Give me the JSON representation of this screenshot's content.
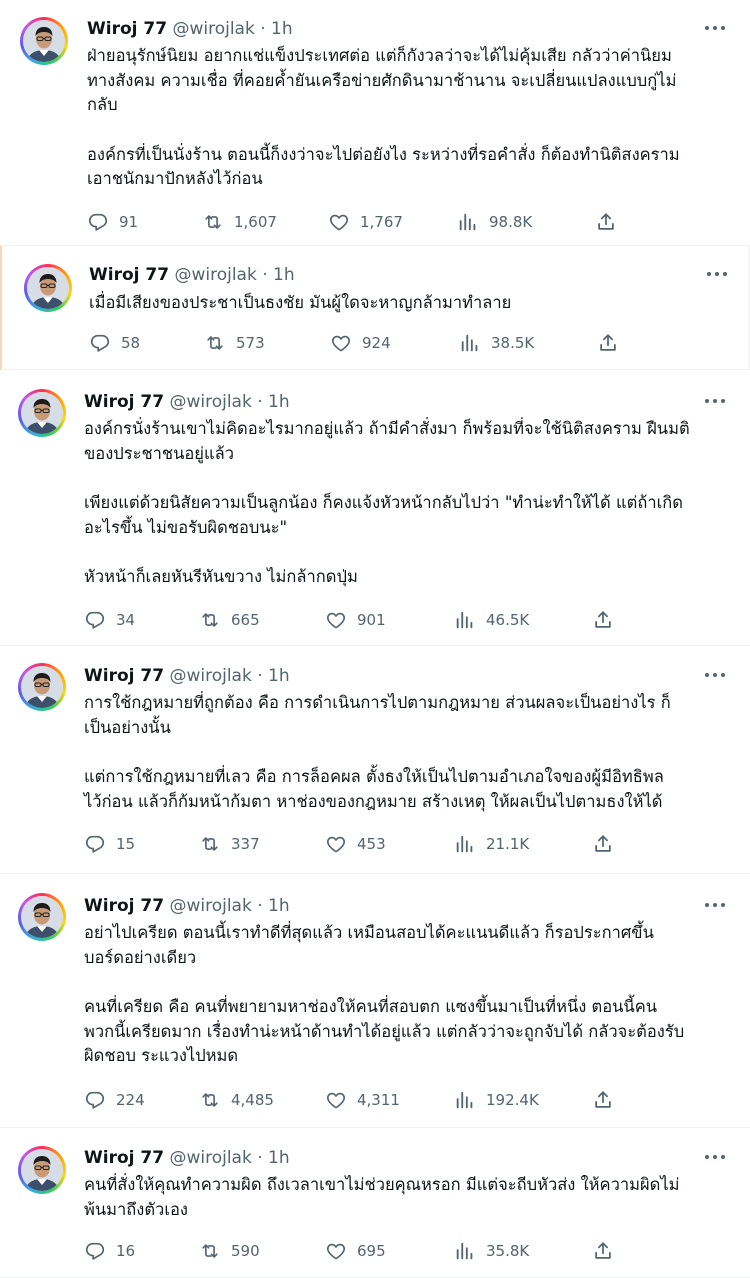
{
  "tweets": [
    {
      "name": "Wiroj 77",
      "handle": "@wirojlak",
      "time": "1h",
      "paragraphs": [
        "ฝ่ายอนุรักษ์นิยม อยากแช่แข็งประเทศต่อ แต่ก็กังวลว่าจะได้ไม่คุ้มเสีย กลัวว่าค่านิยม\nทางสังคม ความเชื่อ ที่คอยค้ำยันเครือข่ายศักดินามาช้านาน จะเปลี่ยนแปลงแบบกู่ไม่\nกลับ",
        "องค์กรที่เป็นนั่งร้าน ตอนนี้ก็งงว่าจะไปต่อยังไง ระหว่างที่รอคำสั่ง ก็ต้องทำนิติสงคราม\nเอาชนักมาปักหลังไว้ก่อน"
      ],
      "replies": "91",
      "retweets": "1,607",
      "likes": "1,767",
      "views": "98.8K"
    },
    {
      "name": "Wiroj 77",
      "handle": "@wirojlak",
      "time": "1h",
      "paragraphs": [
        "เมื่อมีเสียงของประชาเป็นธงชัย มันผู้ใดจะหาญกล้ามาทำลาย"
      ],
      "replies": "58",
      "retweets": "573",
      "likes": "924",
      "views": "38.5K"
    },
    {
      "name": "Wiroj 77",
      "handle": "@wirojlak",
      "time": "1h",
      "paragraphs": [
        "องค์กรนั่งร้านเขาไม่คิดอะไรมากอยู่แล้ว ถ้ามีคำสั่งมา ก็พร้อมที่จะใช้นิติสงคราม ฝืนมติ\nของประชาชนอยู่แล้ว",
        "เพียงแต่ด้วยนิสัยความเป็นลูกน้อง ก็คงแจ้งหัวหน้ากลับไปว่า \"ทำน่ะทำให้ได้ แต่ถ้าเกิด\nอะไรขึ้น ไม่ขอรับผิดชอบนะ\"",
        "หัวหน้าก็เลยหันรีหันขวาง ไม่กล้ากดปุ่ม"
      ],
      "replies": "34",
      "retweets": "665",
      "likes": "901",
      "views": "46.5K"
    },
    {
      "name": "Wiroj 77",
      "handle": "@wirojlak",
      "time": "1h",
      "paragraphs": [
        "การใช้กฎหมายที่ถูกต้อง คือ การดำเนินการไปตามกฎหมาย ส่วนผลจะเป็นอย่างไร ก็\nเป็นอย่างนั้น",
        "แต่การใช้กฎหมายที่เลว คือ การล็อคผล ตั้งธงให้เป็นไปตามอำเภอใจของผู้มีอิทธิพล\nไว้ก่อน แล้วก็ก้มหน้าก้มตา หาช่องของกฎหมาย สร้างเหตุ ให้ผลเป็นไปตามธงให้ได้"
      ],
      "replies": "15",
      "retweets": "337",
      "likes": "453",
      "views": "21.1K"
    },
    {
      "name": "Wiroj 77",
      "handle": "@wirojlak",
      "time": "1h",
      "paragraphs": [
        "อย่าไปเครียด ตอนนี้เราทำดีที่สุดแล้ว เหมือนสอบได้คะแนนดีแล้ว ก็รอประกาศขึ้น\nบอร์ดอย่างเดียว",
        "คนที่เครียด คือ คนที่พยายามหาช่องให้คนที่สอบตก แซงขึ้นมาเป็นที่หนึ่ง ตอนนี้คน\nพวกนี้เครียดมาก เรื่องทำน่ะหน้าด้านทำได้อยู่แล้ว แต่กลัวว่าจะถูกจับได้ กลัวจะต้องรับ\nผิดชอบ ระแวงไปหมด"
      ],
      "replies": "224",
      "retweets": "4,485",
      "likes": "4,311",
      "views": "192.4K"
    },
    {
      "name": "Wiroj 77",
      "handle": "@wirojlak",
      "time": "1h",
      "paragraphs": [
        "คนที่สั่งให้คุณทำความผิด ถึงเวลาเขาไม่ช่วยคุณหรอก มีแต่จะถีบหัวส่ง ให้ความผิดไม่\nพ้นมาถึงตัวเอง"
      ],
      "replies": "16",
      "retweets": "590",
      "likes": "695",
      "views": "35.8K"
    }
  ],
  "icons": [
    "reply-icon",
    "retweet-icon",
    "like-icon",
    "views-icon",
    "share-icon",
    "more-icon"
  ],
  "colors": {
    "text": "#0f1419",
    "secondary": "#536471",
    "divider": "#eff3f4"
  }
}
